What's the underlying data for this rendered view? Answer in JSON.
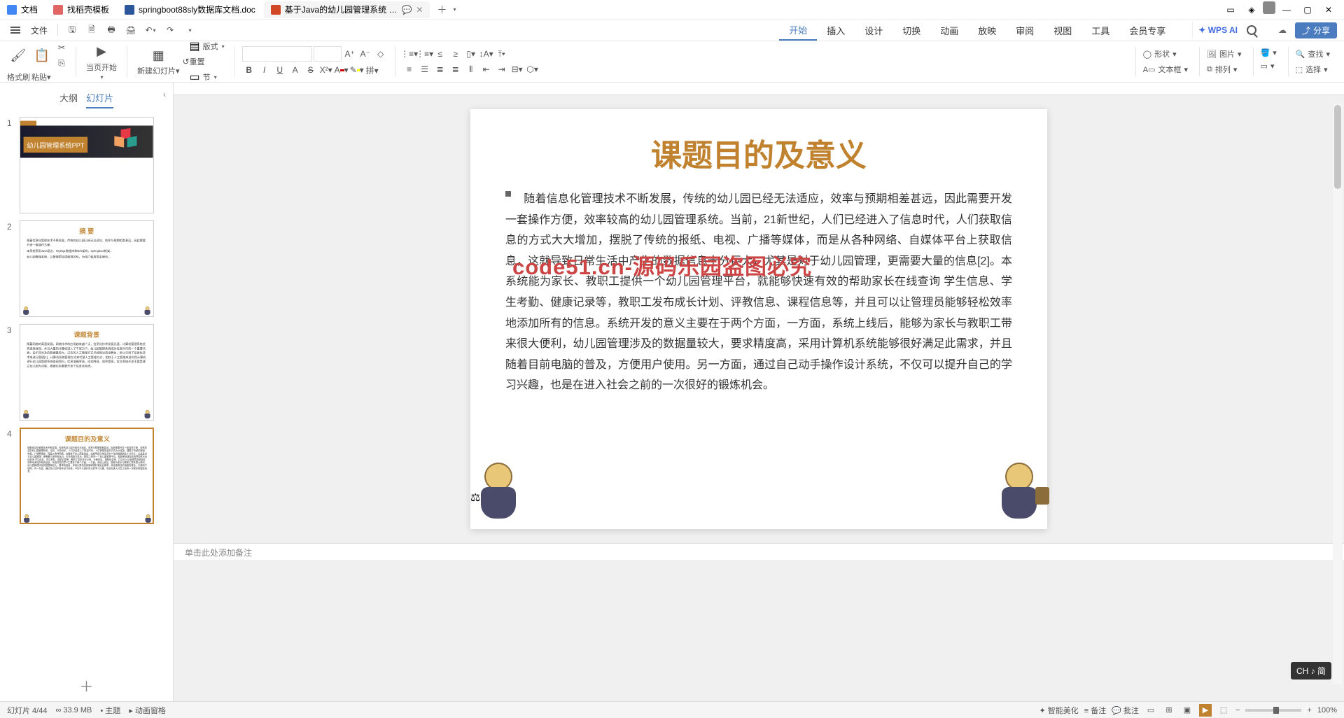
{
  "tabs": [
    {
      "label": "文档",
      "close": false
    },
    {
      "label": "找稻壳模板",
      "close": false
    },
    {
      "label": "springboot88sly数据库文档.doc",
      "close": false
    },
    {
      "label": "基于Java的幼儿园管理系统 …",
      "close": true,
      "active": true
    }
  ],
  "quick": {
    "file": "文件"
  },
  "menu": {
    "items": [
      "开始",
      "插入",
      "设计",
      "切换",
      "动画",
      "放映",
      "审阅",
      "视图",
      "工具",
      "会员专享"
    ],
    "active": "开始",
    "ai": "WPS AI",
    "share": "分享"
  },
  "ribbon": {
    "format_brush": "格式刷",
    "paste": "粘贴",
    "start_from": "当页开始",
    "new_slide": "新建幻灯片",
    "layout": "版式",
    "section": "节",
    "reset": "重置",
    "shape": "形状",
    "image": "图片",
    "textbox": "文本框",
    "arrange": "排列",
    "find": "查找",
    "select": "选择"
  },
  "nav": {
    "outline": "大纲",
    "slides": "幻灯片",
    "thumbs": [
      {
        "num": "1",
        "title": "幼儿园管理系统PPT"
      },
      {
        "num": "2",
        "title": "摘  要",
        "lines": [
          "随着信息化管理技术不断发展，传统的幼儿园已经无法适应，效率与预期相差甚远，因此需要开发一套操作方便...",
          "本系统采用Java语言、MySQL数据库和B/S架构，springboot框架...",
          "幼儿园管理系统，让管理更加清晰规范化，为用户使用带来便利..."
        ]
      },
      {
        "num": "3",
        "title": "课题背景",
        "text": "随着网络的高速发展，网络技术的应用越来越广泛，信息化技术发展迅速，计算机管理系统优势逐渐体现，并且大量的计算机进入了千家万户。幼儿园管理系统成为信息时代的一个重要代表，由于其涉及的数据量较大，过去的人工管理方式已经暗淡退出舞台，所以引用了信息化技术来进行管理[1]。计算机系统管理方式来代替人工管理方式，相较于人工管理来说利用计算机进行幼儿园管理系统查阅资料，信息准确率高，成本降低、效率提高，本次系统开发主要是建立幼儿园为对象，根据实际需要开发个信息化系统。"
      },
      {
        "num": "4",
        "title": "课题目的及意义",
        "selected": true
      }
    ]
  },
  "slide": {
    "title": "课题目的及意义",
    "body": "随着信息化管理技术不断发展，传统的幼儿园已经无法适应，效率与预期相差甚远，因此需要开发一套操作方便，效率较高的幼儿园管理系统。当前，21新世纪，人们已经进入了信息时代，人们获取信息的方式大大增加，摆脱了传统的报纸、电视、广播等媒体，而是从各种网络、自媒体平台上获取信息，这就导致日常生活中产生的数据信息十分巨大，尤其是对于幼儿园管理，更需要大量的信息[2]。本系统能为家长、教职工提供一个幼儿园管理平台，就能够快速有效的帮助家长在线查询 学生信息、学生考勤、健康记录等，教职工发布成长计划、评教信息、课程信息等，并且可以让管理员能够轻松效率地添加所有的信息。系统开发的意义主要在于两个方面，一方面，系统上线后，能够为家长与教职工带来很大便利，幼儿园管理涉及的数据量较大，要求精度高，采用计算机系统能够很好满足此需求，并且随着目前电脑的普及，方便用户使用。另一方面，通过自己动手操作设计系统，不仅可以提升自己的学习兴趣，也是在进入社会之前的一次很好的锻炼机会。",
    "watermark": "code51.cn-源码乐园盗图必究"
  },
  "notes": "单击此处添加备注",
  "status": {
    "left": "幻灯片 4/44",
    "size": "33.9 MB",
    "theme": "主题",
    "fx": "动画窗格",
    "smart": "智能美化",
    "remark": "备注",
    "comment": "批注",
    "zoom": "100%"
  },
  "ime": "CH ♪ 简"
}
